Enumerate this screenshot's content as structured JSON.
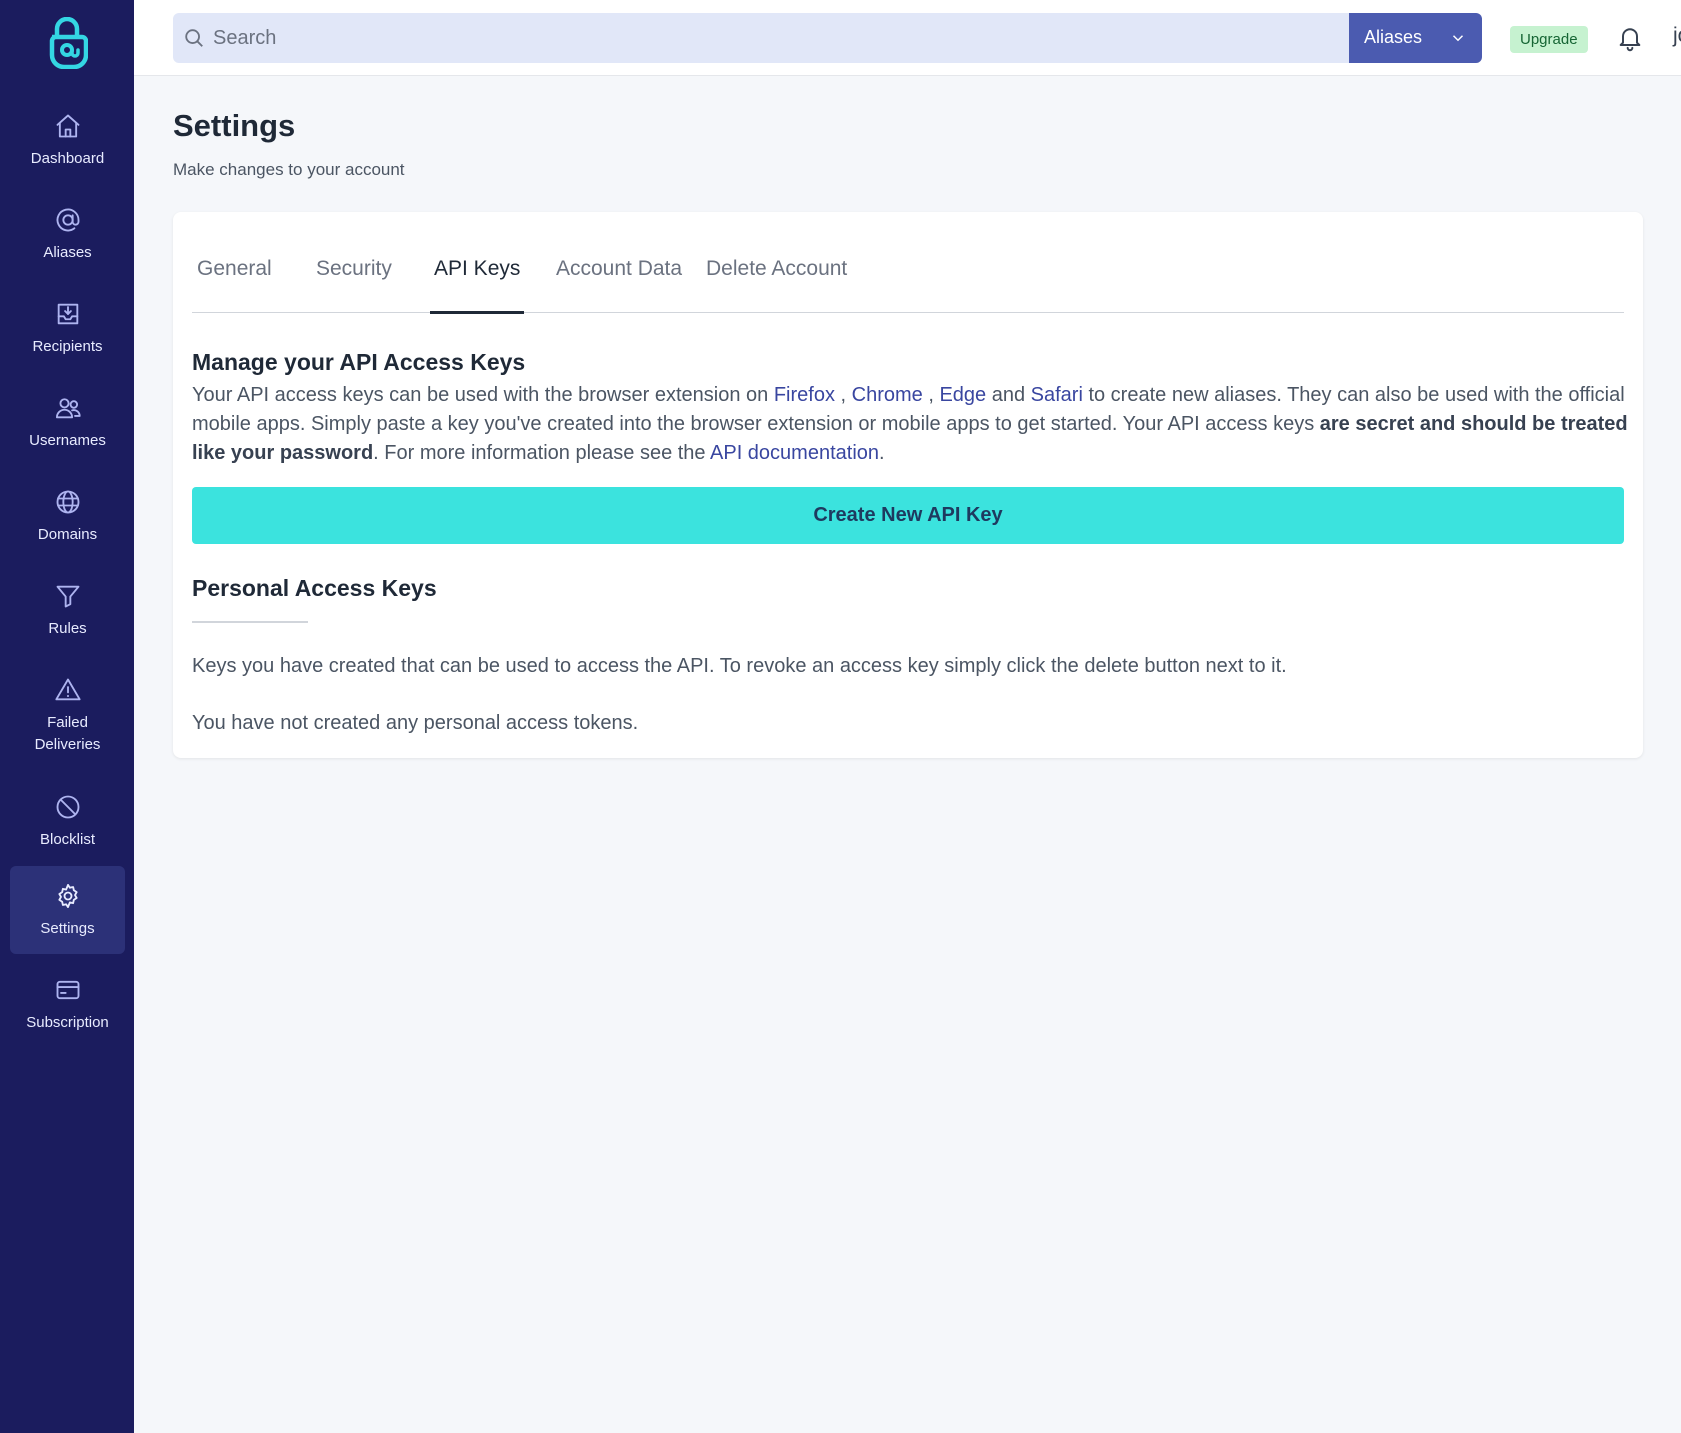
{
  "sidebar": {
    "items": [
      {
        "label": "Dashboard",
        "icon": "home-icon"
      },
      {
        "label": "Aliases",
        "icon": "at-icon"
      },
      {
        "label": "Recipients",
        "icon": "inbox-icon"
      },
      {
        "label": "Usernames",
        "icon": "users-icon"
      },
      {
        "label": "Domains",
        "icon": "globe-icon"
      },
      {
        "label": "Rules",
        "icon": "filter-icon"
      },
      {
        "label": "Failed Deliveries",
        "label_line1": "Failed",
        "label_line2": "Deliveries",
        "icon": "warning-icon"
      },
      {
        "label": "Blocklist",
        "icon": "ban-icon"
      },
      {
        "label": "Settings",
        "icon": "gear-icon",
        "active": true
      },
      {
        "label": "Subscription",
        "icon": "credit-card-icon"
      }
    ]
  },
  "topbar": {
    "search_placeholder": "Search",
    "search_value": "",
    "scope_label": "Aliases",
    "upgrade_label": "Upgrade",
    "username": "johndoe"
  },
  "page": {
    "title": "Settings",
    "subtitle": "Make changes to your account"
  },
  "tabs": [
    {
      "label": "General"
    },
    {
      "label": "Security"
    },
    {
      "label": "API Keys",
      "active": true
    },
    {
      "label": "Account Data"
    },
    {
      "label": "Delete Account"
    }
  ],
  "api": {
    "heading": "Manage your API Access Keys",
    "desc_part1": "Your API access keys can be used with the browser extension on ",
    "link_firefox": "Firefox",
    "sep1": " , ",
    "link_chrome": "Chrome",
    "sep2": " , ",
    "link_edge": "Edge",
    "and": " and ",
    "link_safari": "Safari",
    "desc_part2": " to create new aliases. They can also be used with the official mobile apps. Simply paste a key you've created into the browser extension or mobile apps to get started. Your API access keys ",
    "desc_bold": "are secret and should be treated like your password",
    "desc_part3": ". For more information please see the ",
    "link_docs": "API documentation",
    "desc_end": ".",
    "create_button": "Create New API Key",
    "personal_heading": "Personal Access Keys",
    "personal_desc": "Keys you have created that can be used to access the API. To revoke an access key simply click the delete button next to it.",
    "empty_text": "You have not created any personal access tokens."
  },
  "colors": {
    "sidebar_bg": "#1b1c5e",
    "sidebar_active": "#2c3178",
    "accent_button": "#3be3de",
    "scope_button": "#4b5bb0",
    "link": "#3946a0",
    "upgrade_badge": "#c6f2d0"
  }
}
